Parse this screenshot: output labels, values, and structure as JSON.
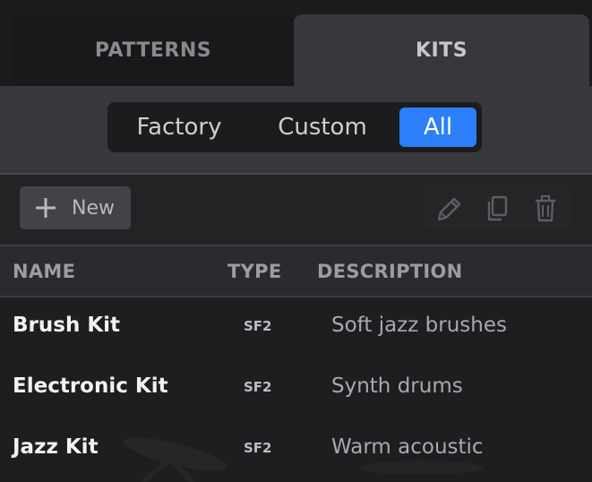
{
  "tabs": [
    {
      "label": "PATTERNS",
      "active": false
    },
    {
      "label": "KITS",
      "active": true
    }
  ],
  "filter": {
    "options": [
      "Factory",
      "Custom",
      "All"
    ],
    "selected": "All"
  },
  "toolbar": {
    "new_label": "New",
    "actions": [
      "edit-icon",
      "copy-icon",
      "trash-icon"
    ]
  },
  "table": {
    "columns": [
      "NAME",
      "TYPE",
      "DESCRIPTION"
    ],
    "rows": [
      {
        "name": "Brush Kit",
        "type": "SF2",
        "description": "Soft jazz brushes"
      },
      {
        "name": "Electronic Kit",
        "type": "SF2",
        "description": "Synth drums"
      },
      {
        "name": "Jazz Kit",
        "type": "SF2",
        "description": "Warm acoustic"
      }
    ]
  },
  "colors": {
    "accent": "#2d7ff9",
    "background": "#1e1e21",
    "panel": "#38383c"
  }
}
